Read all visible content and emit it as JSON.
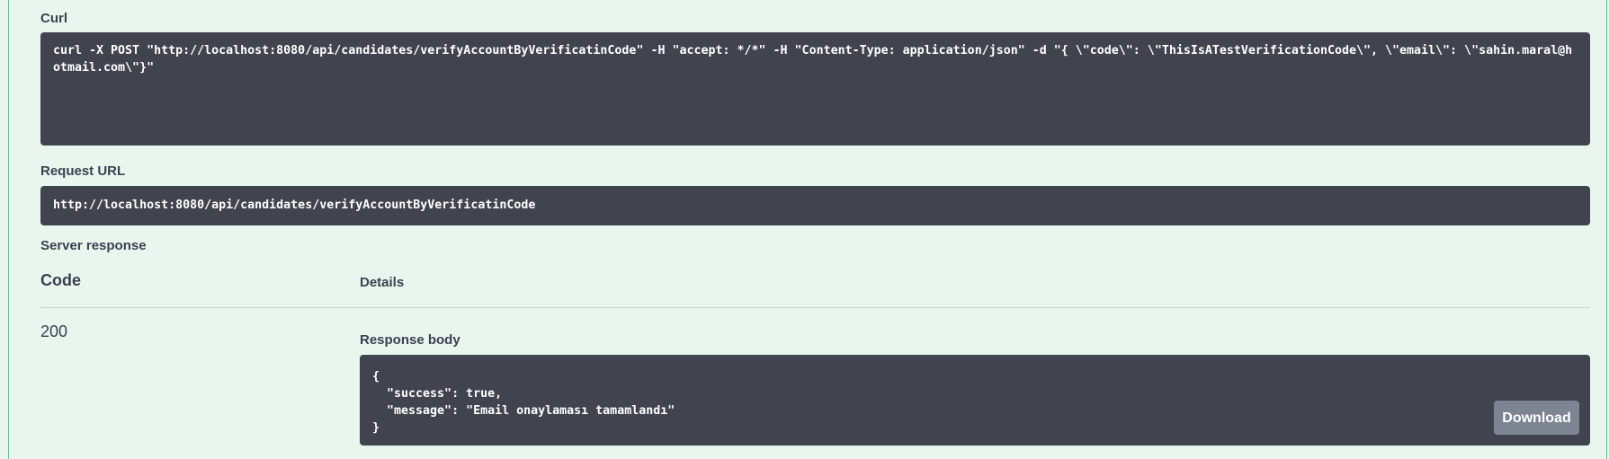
{
  "curl": {
    "label": "Curl",
    "command": "curl -X POST \"http://localhost:8080/api/candidates/verifyAccountByVerificatinCode\" -H \"accept: */*\" -H \"Content-Type: application/json\" -d \"{ \\\"code\\\": \\\"ThisIsATestVerificationCode\\\", \\\"email\\\": \\\"sahin.maral@hotmail.com\\\"}\""
  },
  "request_url": {
    "label": "Request URL",
    "value": "http://localhost:8080/api/candidates/verifyAccountByVerificatinCode"
  },
  "server_response": {
    "label": "Server response",
    "columns": {
      "code": "Code",
      "details": "Details"
    },
    "status_code": "200",
    "response_body_label": "Response body",
    "response_body": "{\n  \"success\": true,\n  \"message\": \"Email onaylaması tamamlandı\"\n}",
    "download_label": "Download"
  },
  "colors": {
    "background": "#e8f6ee",
    "border": "#49cc90",
    "code_bg": "#41444e",
    "download_bg": "#7d8492"
  }
}
